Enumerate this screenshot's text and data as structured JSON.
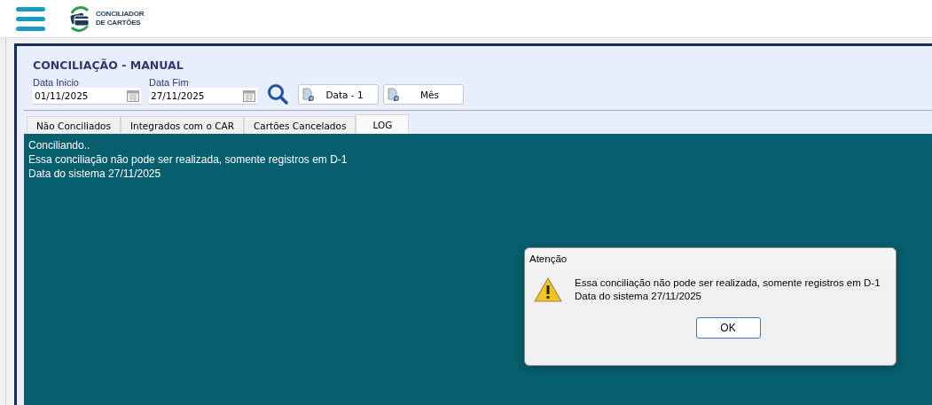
{
  "header": {
    "logo_lines": [
      "CONCILIADOR",
      "DE CARTÕES"
    ]
  },
  "page": {
    "title": "CONCILIAÇÃO - MANUAL",
    "fields": [
      {
        "label": "Data Inicio",
        "value": "01/11/2025"
      },
      {
        "label": "Data Fim",
        "value": "27/11/2025"
      }
    ],
    "buttons": [
      "Data - 1",
      "Mês"
    ]
  },
  "tabs": [
    {
      "label": "Não Conciliados",
      "selected": false
    },
    {
      "label": "Integrados com o CAR",
      "selected": false
    },
    {
      "label": "Cartões Cancelados",
      "selected": false
    },
    {
      "label": "LOG",
      "selected": true
    }
  ],
  "log_lines": [
    "Conciliando..",
    "Essa conciliação não pode ser realizada, somente registros em D-1",
    "Data do sistema 27/11/2025"
  ],
  "dialog": {
    "title": "Atenção",
    "message_lines": [
      "Essa conciliação não pode ser realizada, somente registros em D-1",
      "Data do sistema 27/11/2025"
    ],
    "button": "OK"
  }
}
